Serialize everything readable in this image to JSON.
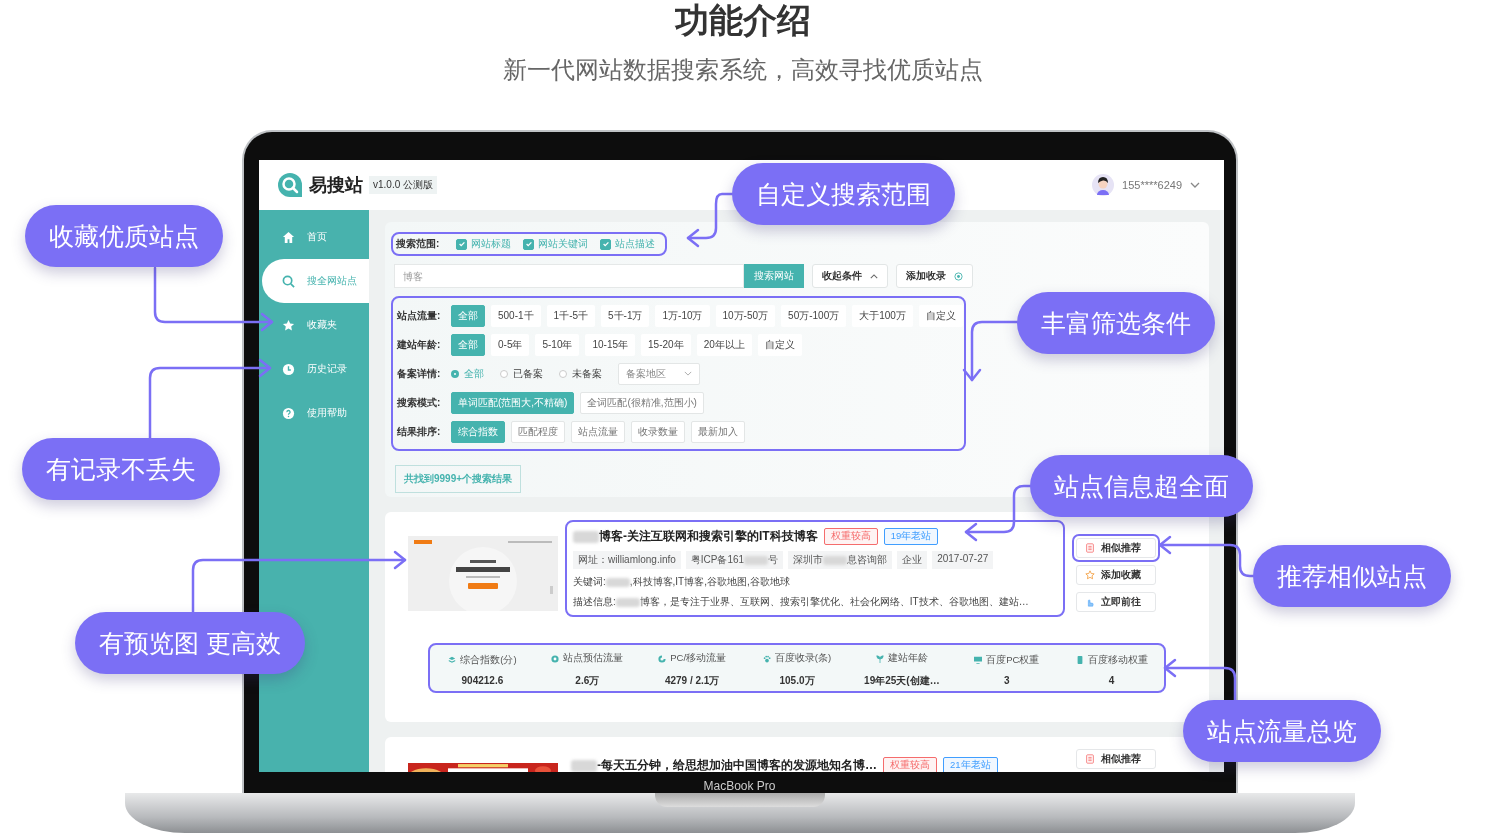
{
  "heading": {
    "title": "功能介绍",
    "subtitle": "新一代网站数据搜索系统，高效寻找优质站点"
  },
  "app": {
    "logo": "易搜站",
    "version": "v1.0.0 公测版",
    "user": "155****6249",
    "nav": [
      {
        "label": "首页",
        "selected": false
      },
      {
        "label": "搜全网站点",
        "selected": true
      },
      {
        "label": "收藏夹",
        "selected": false
      },
      {
        "label": "历史记录",
        "selected": false
      },
      {
        "label": "使用帮助",
        "selected": false
      }
    ],
    "scope": {
      "label": "搜索范围:",
      "options": [
        {
          "label": "网站标题",
          "checked": true
        },
        {
          "label": "网站关键词",
          "checked": true
        },
        {
          "label": "站点描述",
          "checked": true
        }
      ]
    },
    "search": {
      "placeholder": "博客",
      "button": "搜索网站",
      "collapse": "收起条件",
      "add": "添加收录"
    },
    "filters": [
      {
        "label": "站点流量:",
        "kind": "chips",
        "options": [
          {
            "label": "全部",
            "selected": true
          },
          {
            "label": "500-1千",
            "selected": false
          },
          {
            "label": "1千-5千",
            "selected": false
          },
          {
            "label": "5千-1万",
            "selected": false
          },
          {
            "label": "1万-10万",
            "selected": false
          },
          {
            "label": "10万-50万",
            "selected": false
          },
          {
            "label": "50万-100万",
            "selected": false
          },
          {
            "label": "大于100万",
            "selected": false
          },
          {
            "label": "自定义",
            "selected": false
          }
        ]
      },
      {
        "label": "建站年龄:",
        "kind": "chips",
        "options": [
          {
            "label": "全部",
            "selected": true
          },
          {
            "label": "0-5年",
            "selected": false
          },
          {
            "label": "5-10年",
            "selected": false
          },
          {
            "label": "10-15年",
            "selected": false
          },
          {
            "label": "15-20年",
            "selected": false
          },
          {
            "label": "20年以上",
            "selected": false
          },
          {
            "label": "自定义",
            "selected": false
          }
        ]
      },
      {
        "label": "备案详情:",
        "kind": "radios",
        "options": [
          {
            "label": "全部",
            "selected": true
          },
          {
            "label": "已备案",
            "selected": false
          },
          {
            "label": "未备案",
            "selected": false
          }
        ],
        "select_placeholder": "备案地区"
      },
      {
        "label": "搜索模式:",
        "kind": "outlined",
        "options": [
          {
            "label": "单词匹配(范围大,不精确)",
            "selected": true
          },
          {
            "label": "全词匹配(很精准,范围小)",
            "selected": false
          }
        ]
      },
      {
        "label": "结果排序:",
        "kind": "outlined",
        "options": [
          {
            "label": "综合指数",
            "selected": true
          },
          {
            "label": "匹配程度",
            "selected": false
          },
          {
            "label": "站点流量",
            "selected": false
          },
          {
            "label": "收录数量",
            "selected": false
          },
          {
            "label": "最新加入",
            "selected": false
          }
        ]
      }
    ],
    "result_count": "共找到9999+个搜索结果",
    "results": [
      {
        "title": "博客-关注互联网和搜索引擎的IT科技博客",
        "badges": [
          {
            "label": "权重较高",
            "color": "#f56c6c"
          },
          {
            "label": "19年老站",
            "color": "#409eff"
          }
        ],
        "meta": [
          {
            "segments": [
              "网址：williamlong.info"
            ]
          },
          {
            "segments": [
              "粤ICP备161",
              "号"
            ]
          },
          {
            "segments": [
              "深圳市",
              "息咨询部"
            ]
          },
          {
            "segments": [
              "企业"
            ]
          },
          {
            "segments": [
              "2017-07-27"
            ]
          }
        ],
        "keywords": [
          "关键词:",
          ",科技博客,IT博客,谷歌地图,谷歌地球"
        ],
        "description": [
          "描述信息:",
          "博客，是专注于业界、互联网、搜索引擎优化、社会化网络、IT技术、谷歌地图、建站…"
        ],
        "actions": [
          {
            "label": "相似推荐"
          },
          {
            "label": "添加收藏"
          },
          {
            "label": "立即前往"
          }
        ],
        "stats": [
          {
            "label": "综合指数(分)",
            "value": "904212.6"
          },
          {
            "label": "站点预估流量",
            "value": "2.6万"
          },
          {
            "label": "PC/移动流量",
            "value": "4279 / 2.1万"
          },
          {
            "label": "百度收录(条)",
            "value": "105.0万"
          },
          {
            "label": "建站年龄",
            "value": "19年25天(创建…"
          },
          {
            "label": "百度PC权重",
            "value": "3"
          },
          {
            "label": "百度移动权重",
            "value": "4"
          }
        ]
      },
      {
        "title": "-每天五分钟，给思想加油中国博客的发源地知名博…",
        "badges": [
          {
            "label": "权重较高",
            "color": "#f56c6c"
          },
          {
            "label": "21年老站",
            "color": "#409eff"
          }
        ],
        "actions": [
          {
            "label": "相似推荐"
          }
        ]
      }
    ]
  },
  "callouts": [
    "自定义搜索范围",
    "收藏优质站点",
    "有记录不丢失",
    "丰富筛选条件",
    "站点信息超全面",
    "推荐相似站点",
    "有预览图 更高效",
    "站点流量总览"
  ],
  "device_label": "MacBook Pro"
}
